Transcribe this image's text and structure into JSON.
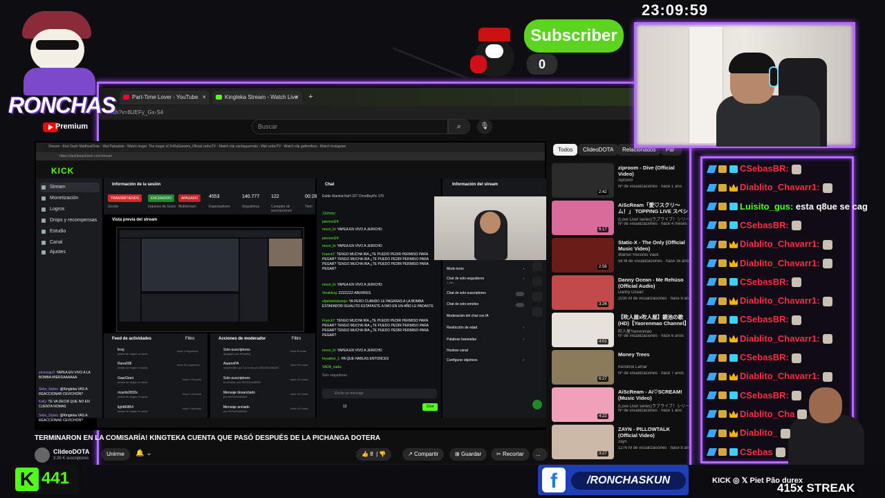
{
  "overlay": {
    "clock": "23:09:59",
    "subscriber_label": "Subscriber",
    "subscriber_count": "0",
    "brand_logo": "RONCHAS",
    "kick_count": "441",
    "kick_letter": "K",
    "facebook_handle": "/RONCHASKUN",
    "facebook_letter": "f",
    "socials_label": "KICK ◎ 𝕏 Piet Pão durex",
    "streak": "415x STREAK"
  },
  "browser": {
    "tabs": [
      {
        "title": "Part-Time Lover - YouTube"
      },
      {
        "title": "Kingteka Stream - Watch Live"
      }
    ],
    "new_tab": "+",
    "url": "ch?v=8UEFy_Gx-S4",
    "yt_brand": "Premium",
    "search_placeholder": "Buscar"
  },
  "kick_dashboard": {
    "tabs_strip": "Stream - Kick Dash   MatthewDota - Wat   Pakadota - Watch   Imgur: The magic of   ZeRaGamers_Oficial   cerboTV - Watch clip   sachaguzmaki - Wat   cerboTV - Watch clip   gabimifera - Watch   Instagram",
    "url": "https://dashboard.kick.com/stream",
    "logo": "KICK",
    "sidebar": [
      {
        "label": "Stream"
      },
      {
        "label": "Monetización"
      },
      {
        "label": "Logros"
      },
      {
        "label": "Drops y recompensas"
      },
      {
        "label": "Estudio"
      },
      {
        "label": "Canal"
      },
      {
        "label": "Ajustes"
      }
    ],
    "session_title": "Información de la sesión",
    "session_buttons": [
      "TRANSMITIENDO",
      "ENCENDIDO",
      "APAGADO"
    ],
    "session_stats": [
      {
        "value": "4553",
        "label": "Espectadores"
      },
      {
        "value": "140.777",
        "label": "Seguidores"
      },
      {
        "value": "122",
        "label": "Contador de suscripciones"
      },
      {
        "value": "00:28",
        "label": "Tiem"
      }
    ],
    "session_labels": [
      "Sesión",
      "Ingresos de Socio",
      "Multistream"
    ],
    "preview_title": "Vista previa del stream",
    "feed_title": "Feed de actividades",
    "feed_filter": "Filtro",
    "feed": [
      {
        "user": "froxj",
        "note": "acaba de seguir el canal",
        "time": "hace 4 segundos"
      },
      {
        "user": "Rana008",
        "note": "acaba de seguir el canal",
        "time": "hace 44 segundos"
      },
      {
        "user": "GaarGiant",
        "note": "acaba de seguir el canal",
        "time": "hace 3 minutos"
      },
      {
        "user": "ricardo2832s",
        "note": "acaba de seguir el canal",
        "time": "hace 3 minutos"
      },
      {
        "user": "light80854",
        "note": "acaba de seguir el canal",
        "time": "hace 3 minutos"
      }
    ],
    "mod_title": "Acciones de moderador",
    "mod_filter": "Filtro",
    "mod": [
      {
        "title": "Solo-suscriptores",
        "note": "apagado por Kingteka",
        "time": "hace 6 horas"
      },
      {
        "title": "AaaronPA",
        "note": "suspendido por 12 horas por ANTAHUAMAN",
        "time": "hace 20 horas"
      },
      {
        "title": "Solo-suscriptores",
        "note": "encendido por ANTAHUAMAN",
        "time": "hace 21 horas"
      },
      {
        "title": "Mensaje desanclado",
        "note": "por ANTAHUAMAN",
        "time": "hace 21 horas"
      },
      {
        "title": "Mensaje anclado",
        "note": "por ANTAHUAMAN",
        "time": "hace 21 horas"
      }
    ],
    "chat_title": "Chat",
    "pinned": "Eddie   MamitaYIaH 227   ChrisBoyPe 170",
    "chat_lines": [
      {
        "user": "13chrisz:",
        "text": ""
      },
      {
        "user": "pierooni24:",
        "text": ""
      },
      {
        "user": "moon_lit:",
        "text": "YAPEA EN VIVO A JERICHO"
      },
      {
        "user": "pierooni24:",
        "text": ""
      },
      {
        "user": "moon_lit:",
        "text": "YAPEA EN VIVO A JERICHO"
      },
      {
        "user": "Franck7:",
        "text": "TENGO MUCHA IRA ¿TE PUEDO PEDIR PERMISO PARA PEGAR? TENGO MUCHA IRA ¿TE PUEDO PEDIR PERMISO PARA PEGAR? TENGO MUCHA IRA ¿TE PUEDO PEDIR PERMISO PARA PEGAR?"
      },
      {
        "user": "moon_lit:",
        "text": "YAPEA EN VIVO A JERICHO"
      },
      {
        "user": "Vorakkog:",
        "text": "ZZZZZZZ ABURRES"
      },
      {
        "user": "elpelotelotaviejo:",
        "text": "YA PERO CUANDO LE PAGARAS A LA BOMBA ESTAFADOR IGUALITO ESTAFASTE A IWO EN UN AÑO LE PADASTE"
      },
      {
        "user": "Franck7:",
        "text": "TENGO MUCHA IRA ¿TE PUEDO PEDIR PERMISO PARA PEGAR? TENGO MUCHA IRA ¿TE PUEDO PEDIR PERMISO PARA PEGAR? TENGO MUCHA IRA ¿TE PUEDO PEDIR PERMISO PARA PEGAR?"
      },
      {
        "user": "moon_lit:",
        "text": "YAPEA EN VIVO A JERICHO"
      },
      {
        "user": "bryadmir_1:",
        "text": "PA QUE HABLAS ENTONCES"
      },
      {
        "user": "VADA_vada:",
        "text": ""
      }
    ],
    "chat_followers_label": "Solo seguidores",
    "chat_placeholder": "Enviar un mensaje",
    "chat_count": "12",
    "chat_button": "Chat",
    "info_title": "Información del stream",
    "menu": [
      {
        "label": "Modo lento",
        "sub": ""
      },
      {
        "label": "Chat de solo-seguidores",
        "sub": "1 min"
      },
      {
        "label": "Chat de solo-suscriptores",
        "sub": ""
      },
      {
        "label": "Chat de solo-emotes",
        "sub": ""
      },
      {
        "label": "Moderación del chat con IA",
        "sub": ""
      },
      {
        "label": "Restricción de edad",
        "sub": ""
      },
      {
        "label": "Palabras baneadas",
        "sub": ""
      },
      {
        "label": "Hostear canal",
        "sub": ""
      },
      {
        "label": "Configurar objetivos",
        "sub": ""
      }
    ],
    "left_chat": [
      {
        "user": "pinsosqu2:",
        "text": "YAPEA EN VIVO A LA BOMBA MIERDAAAAAA"
      },
      {
        "user": "Sebs_Styles:",
        "text": "@Kingteka VAS A REACCIONAR CEVICHON?"
      },
      {
        "user": "Kelly:",
        "text": "TE VA DECIR QUE NO EN CUENTA NOMAS"
      },
      {
        "user": "Sebs_Styles:",
        "text": "@Kingteka VAS A REACCIONAR CEVICHON?"
      }
    ]
  },
  "video": {
    "title": "TERMINARON EN LA COMISARÍA! KINGTEKA CUENTA QUE PASÓ DESPUÉS DE LA PICHANGA DOTERA",
    "channel": "ClideoDOTA",
    "subscribers": "3.39 K suscriptores",
    "join_label": "Unirme",
    "likes": "8",
    "actions": [
      "Compartir",
      "Guardar",
      "Recortar"
    ],
    "more": "..."
  },
  "related": {
    "chips": [
      "Todos",
      "ClideoDOTA",
      "Relacionados",
      "Par"
    ],
    "items": [
      {
        "title": "ziproom - Dive (Official Video)",
        "channel": "ziproom",
        "meta": "Nº de visualizaciones · hace 1 año",
        "duration": "2:42",
        "color": "#2a2a2a"
      },
      {
        "title": "AiScReam「愛♡スクリ～ム！」 TOPPING LIVE スペシャルVer.",
        "channel": "(Love Live! series)ラブライブ！シリーズ",
        "meta": "Nº de visualizaciones · hace 4 meses",
        "duration": "6:17",
        "color": "#d86a9a"
      },
      {
        "title": "Static-X - The Only (Official Music Video)",
        "channel": "Warner Records Vault",
        "meta": "56 M de visualizaciones · hace 16 años",
        "duration": "2:56",
        "color": "#6a1c18"
      },
      {
        "title": "Danny Ocean - Me Rehúso (Official Audio)",
        "channel": "Danny Ocean",
        "meta": "2030 M de visualizaciones · hace 9 años",
        "duration": "3:26",
        "color": "#c34a4a"
      },
      {
        "title": "【吹人屋x吹人屋】鏡池の歌 (HD)【Yaorenmao Channel】",
        "channel": "吹人屋Yaorenmao",
        "meta": "Nº de visualizaciones · hace 6 años",
        "duration": "4:01",
        "color": "#e7e1dc"
      },
      {
        "title": "Money Trees",
        "channel": "Kendrick Lamar",
        "meta": "Nº de visualizaciones · hace 7 años",
        "duration": "6:27",
        "color": "#8a7c5a"
      },
      {
        "title": "AiScReam - Ai♡SCREAM! (Music Video)",
        "channel": "(Love Live! series)ラブライブ！シリーズ",
        "meta": "Nº de visualizaciones · hace 1 año",
        "duration": "4:22",
        "color": "#f0a0b8"
      },
      {
        "title": "ZAYN - PILLOWTALK (Official Video)",
        "channel": "zayn",
        "meta": "1276 M de visualizaciones · hace 9 años",
        "duration": "3:27",
        "color": "#c9b9a6"
      }
    ]
  },
  "stream_chat": [
    {
      "user": "CSebasBR:",
      "message": "",
      "style": "red",
      "crown": false
    },
    {
      "user": "Diablito_Chavarr1:",
      "message": "",
      "style": "red",
      "crown": true
    },
    {
      "user": "Luisito_gus:",
      "message": "esta q8ue se cag",
      "style": "green",
      "crown": false
    },
    {
      "user": "CSebasBR:",
      "message": "",
      "style": "red",
      "crown": false
    },
    {
      "user": "Diablito_Chavarr1:",
      "message": "",
      "style": "red",
      "crown": true
    },
    {
      "user": "Diablito_Chavarr1:",
      "message": "",
      "style": "red",
      "crown": true
    },
    {
      "user": "CSebasBR:",
      "message": "",
      "style": "red",
      "crown": false
    },
    {
      "user": "Diablito_Chavarr1:",
      "message": "",
      "style": "red",
      "crown": true
    },
    {
      "user": "CSebasBR:",
      "message": "",
      "style": "red",
      "crown": false
    },
    {
      "user": "Diablito_Chavarr1:",
      "message": "",
      "style": "red",
      "crown": true
    },
    {
      "user": "CSebasBR:",
      "message": "",
      "style": "red",
      "crown": false
    },
    {
      "user": "Diablito_Chavarr1:",
      "message": "",
      "style": "red",
      "crown": true
    },
    {
      "user": "CSebasBR:",
      "message": "",
      "style": "red",
      "crown": false
    },
    {
      "user": "Diablito_Cha",
      "message": "",
      "style": "red",
      "crown": true
    },
    {
      "user": "Diablito_",
      "message": "",
      "style": "red",
      "crown": true
    },
    {
      "user": "CSebas",
      "message": "",
      "style": "red",
      "crown": false
    }
  ],
  "colors": {
    "kick_green": "#53fc18",
    "frame_purple": "#b56cff",
    "chat_red": "#ff2a46",
    "facebook_blue": "#1877f2",
    "youtube_red": "#ff0000"
  }
}
